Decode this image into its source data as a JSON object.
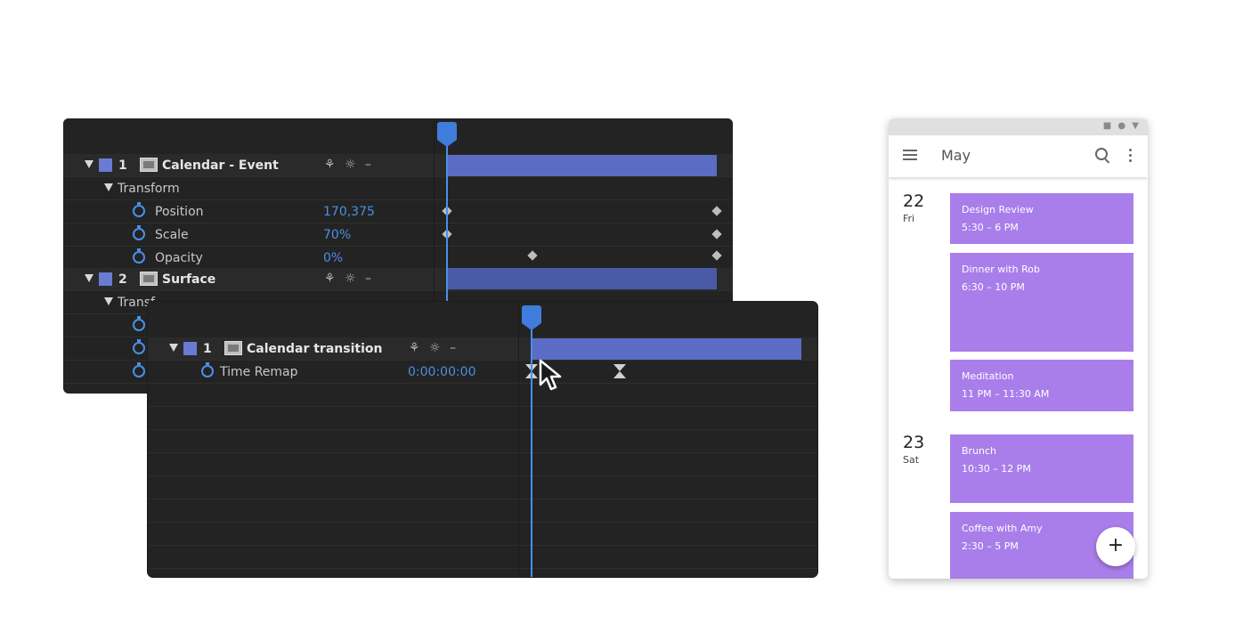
{
  "back_timeline": {
    "layers": [
      {
        "index": "1",
        "name": "Calendar - Event",
        "switches": "⚘ ☼ –"
      },
      {
        "index": "2",
        "name": "Surface",
        "switches": "⚘ ☼ –"
      }
    ],
    "transform_label": "Transform",
    "transform_label_2": "Transf",
    "properties": [
      {
        "name": "Position",
        "value": "170,375"
      },
      {
        "name": "Scale",
        "value": "70%"
      },
      {
        "name": "Opacity",
        "value": "0%"
      }
    ]
  },
  "front_timeline": {
    "layer": {
      "index": "1",
      "name": "Calendar transition",
      "switches": "⚘ ☼ –"
    },
    "property": {
      "name": "Time Remap",
      "value": "0:00:00:00"
    }
  },
  "phone": {
    "status_icons": "■ ● ▼",
    "title": "May",
    "days": [
      {
        "num": "22",
        "name": "Fri",
        "events": [
          {
            "title": "Design Review",
            "time": "5:30 – 6 PM"
          },
          {
            "title": "Dinner with Rob",
            "time": "6:30 – 10 PM"
          },
          {
            "title": "Meditation",
            "time": "11 PM – 11:30 AM"
          }
        ]
      },
      {
        "num": "23",
        "name": "Sat",
        "events": [
          {
            "title": "Brunch",
            "time": "10:30 – 12 PM"
          },
          {
            "title": "Coffee with Amy",
            "time": "2:30 – 5 PM"
          }
        ]
      }
    ],
    "fab_label": "+"
  },
  "colors": {
    "accent_blue": "#4a90e2",
    "layer_bar": "#5a6cc4",
    "event_purple": "#a97eea",
    "panel_bg": "#232323"
  }
}
